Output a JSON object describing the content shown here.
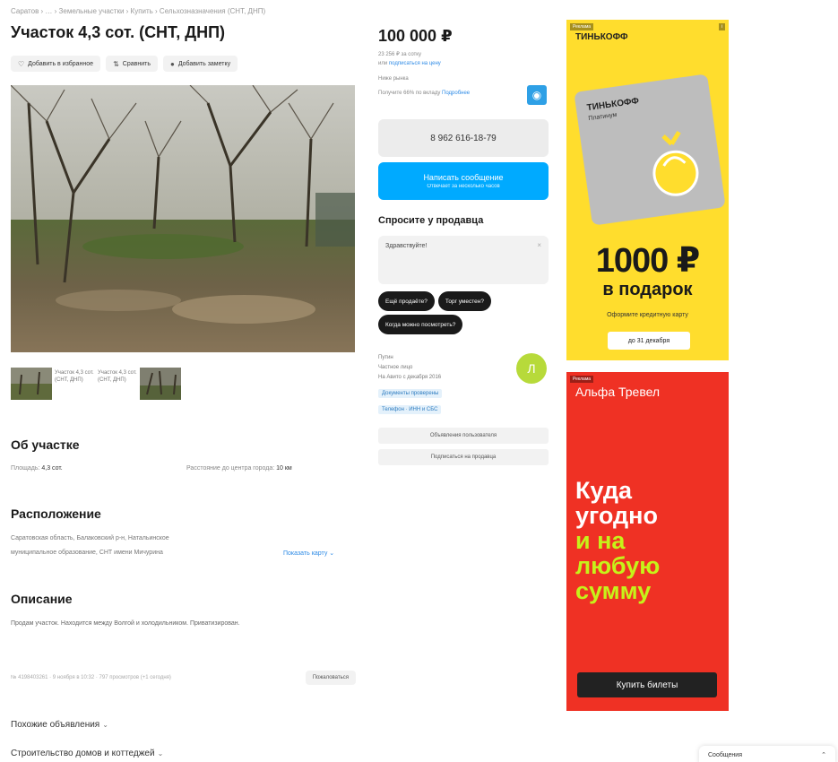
{
  "breadcrumb": "Саратов › … › Земельные участки › Купить › Сельхозназначения (СНТ, ДНП)",
  "title": "Участок 4,3 сот. (СНТ, ДНП)",
  "actions": {
    "favorite": "Добавить в избранное",
    "compare": "Сравнить",
    "note": "Добавить заметку"
  },
  "thumbs": {
    "broken_1": "Участок 4,3 сот. (СНТ, ДНП)",
    "broken_2": "Участок 4,3 сот. (СНТ, ДНП)"
  },
  "about": {
    "title": "Об участке",
    "area_label": "Площадь:",
    "area_value": "4,3 сот.",
    "distance_label": "Расстояние до центра города:",
    "distance_value": "10 км"
  },
  "location": {
    "title": "Расположение",
    "address_line1": "Саратовская область, Балаковский р-н, Натальинское",
    "address_line2": "муниципальное образование, СНТ имени Мичурина",
    "show_map": "Показать карту"
  },
  "description": {
    "title": "Описание",
    "text": "Продам участок. Находится между Волгой и холодильником. Приватизирован."
  },
  "meta": {
    "info": "№ 4198403261 · 9 ноября в 10:32 · 797 просмотров (+1 сегодня)",
    "complain": "Пожаловаться"
  },
  "collapsibles": {
    "similar": "Похожие объявления",
    "construction": "Строительство домов и коттеджей"
  },
  "price": {
    "value": "100 000 ₽",
    "per_unit": "23 256 ₽ за сотку",
    "history_prefix": "или",
    "history_link": "подписаться на цену",
    "market": "Ниже рынка",
    "loan": "Получите 66% по вкладу",
    "loan_link": "Подробнее"
  },
  "contact": {
    "phone": "8 962 616-18-79",
    "message_label": "Написать сообщение",
    "message_sub": "Отвечает за несколько часов"
  },
  "ask": {
    "title": "Спросите у продавца",
    "input_value": "Здравствуйте!",
    "chips": [
      "Ещё продаёте?",
      "Торг уместен?",
      "Когда можно посмотреть?"
    ]
  },
  "seller": {
    "name": "Путин",
    "type": "Частное лицо",
    "since": "На Авито с декабря 2016",
    "tag1": "Документы проверены",
    "tag2": "Телефон · ИНН и СБС",
    "avatar_letter": "Л",
    "all_ads": "Объявления пользователя",
    "subscribe": "Подписаться на продавца"
  },
  "ad_tinkoff": {
    "brand": "ТИНЬКОФФ",
    "card_brand": "ТИНЬКОФФ",
    "card_sub": "Платинум",
    "amount": "1000 ₽",
    "gift": "в подарок",
    "cta": "Оформите кредитную карту",
    "deadline": "до 31 декабря",
    "mark": "Реклама"
  },
  "ad_alfa": {
    "brand": "Альфа Тревел",
    "line1": "Куда",
    "line2": "угодно",
    "line3": "и на",
    "line4": "любую",
    "line5": "сумму",
    "button": "Купить билеты",
    "mark": "Реклама"
  },
  "messages": {
    "label": "Сообщения"
  },
  "colors": {
    "accent": "#00aaff",
    "tinkoff_yellow": "#ffdd2d",
    "alfa_red": "#ef3124",
    "alfa_lime": "#c6f21a",
    "avatar": "#b7da3a"
  }
}
